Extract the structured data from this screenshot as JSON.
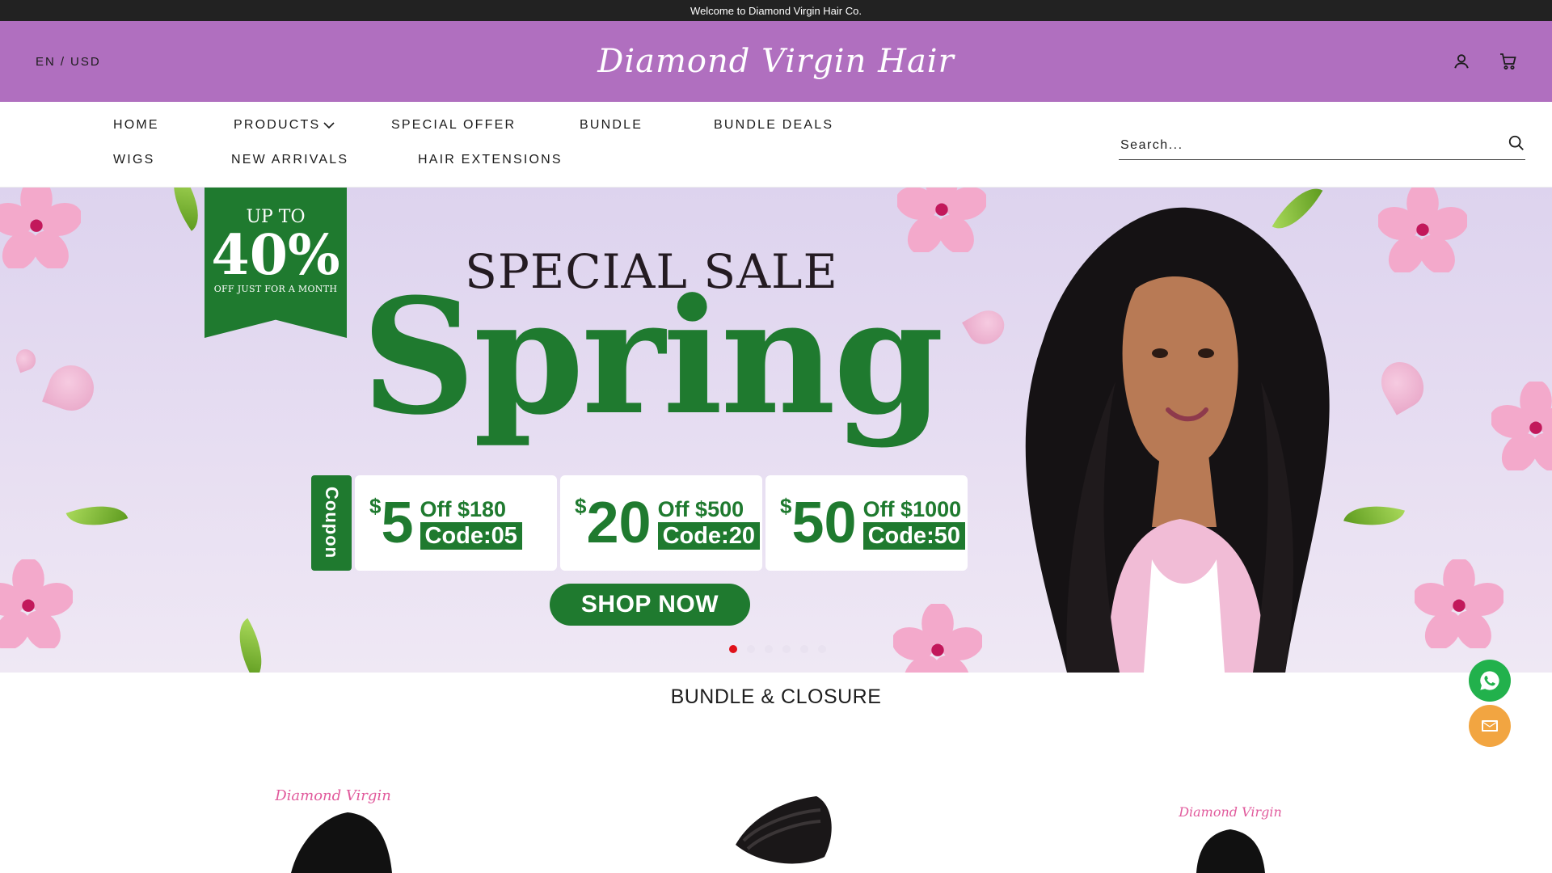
{
  "announcement": "Welcome to Diamond Virgin Hair Co.",
  "header": {
    "language": "EN",
    "separator": "/",
    "currency": "USD",
    "logo_text": "Diamond Virgin Hair",
    "icons": [
      "account-icon",
      "cart-icon"
    ],
    "background": "#b06fbf"
  },
  "nav": {
    "items": [
      "HOME",
      "PRODUCTS",
      "SPECIAL OFFER",
      "BUNDLE",
      "BUNDLE DEALS",
      "WIGS",
      "NEW ARRIVALS",
      "HAIR EXTENSIONS"
    ],
    "search_placeholder": "Search..."
  },
  "hero": {
    "ribbon": {
      "line1": "UP TO",
      "line2": "40%",
      "line3": "OFF JUST FOR A MONTH"
    },
    "title": "SPECIAL SALE",
    "headline": "Spring",
    "coupon_label": "Coupon",
    "coupons": [
      {
        "currency": "$",
        "amount": "5",
        "off": "Off $180",
        "code": "Code:05"
      },
      {
        "currency": "$",
        "amount": "20",
        "off": "Off $500",
        "code": "Code:20"
      },
      {
        "currency": "$",
        "amount": "50",
        "off": "Off $1000",
        "code": "Code:50"
      }
    ],
    "cta": "SHOP NOW",
    "slides_count": 6,
    "active_slide": 1,
    "accent_green": "#1f7a2f"
  },
  "section": {
    "title": "BUNDLE & CLOSURE"
  },
  "floating": {
    "whatsapp_color": "#22b14c",
    "email_color": "#f2a541"
  }
}
